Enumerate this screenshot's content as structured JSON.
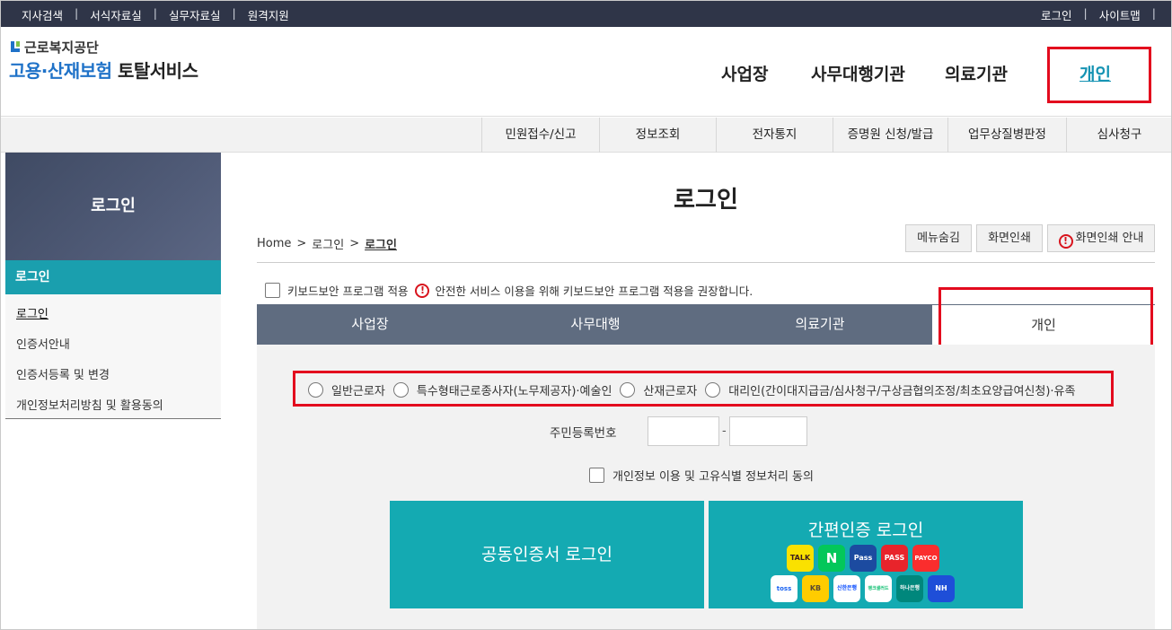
{
  "topbar": {
    "left": [
      "지사검색",
      "서식자료실",
      "실무자료실",
      "원격지원"
    ],
    "right": [
      "로그인",
      "사이트맵"
    ],
    "sep": "|"
  },
  "logo": {
    "org": "근로복지공단",
    "title_blue": "고용·산재보험",
    "title_dark": "토탈서비스"
  },
  "gnb": [
    "사업장",
    "사무대행기관",
    "의료기관",
    "개인"
  ],
  "subnav": [
    "민원접수/신고",
    "정보조회",
    "전자통지",
    "증명원 신청/발급",
    "업무상질병판정",
    "심사청구"
  ],
  "sidebar": {
    "title": "로그인",
    "active": "로그인",
    "items": [
      "로그인",
      "인증서안내",
      "인증서등록 및 변경",
      "개인정보처리방침 및 활용동의"
    ]
  },
  "page": {
    "title": "로그인",
    "breadcrumb": [
      "Home",
      "로그인",
      "로그인"
    ],
    "breadcrumb_sep": ">",
    "buttons": [
      "메뉴숨김",
      "화면인쇄",
      "화면인쇄 안내"
    ]
  },
  "keyboard": {
    "label": "키보드보안 프로그램 적용",
    "notice": "안전한 서비스 이용을 위해 키보드보안 프로그램 적용을 권장합니다."
  },
  "tabs": [
    "사업장",
    "사무대행",
    "의료기관",
    "개인"
  ],
  "radios": [
    "일반근로자",
    "특수형태근로종사자(노무제공자)·예술인",
    "산재근로자",
    "대리인(간이대지급금/심사청구/구상금협의조정/최초요양급여신청)·유족"
  ],
  "rrn": {
    "label": "주민등록번호",
    "dash": "-"
  },
  "agree": {
    "label": "개인정보 이용 및 고유식별 정보처리 동의"
  },
  "login": {
    "cert": "공동인증서 로그인",
    "easy": "간편인증 로그인",
    "providers": [
      "TALK",
      "N",
      "Pass",
      "PASS",
      "PAYCO",
      "toss",
      "KB",
      "신한은행",
      "뱅크샐러드",
      "하나은행",
      "NH"
    ]
  },
  "colors": {
    "teal": "#14aab2",
    "navy": "#2f3548",
    "highlight": "#e30b1e"
  }
}
